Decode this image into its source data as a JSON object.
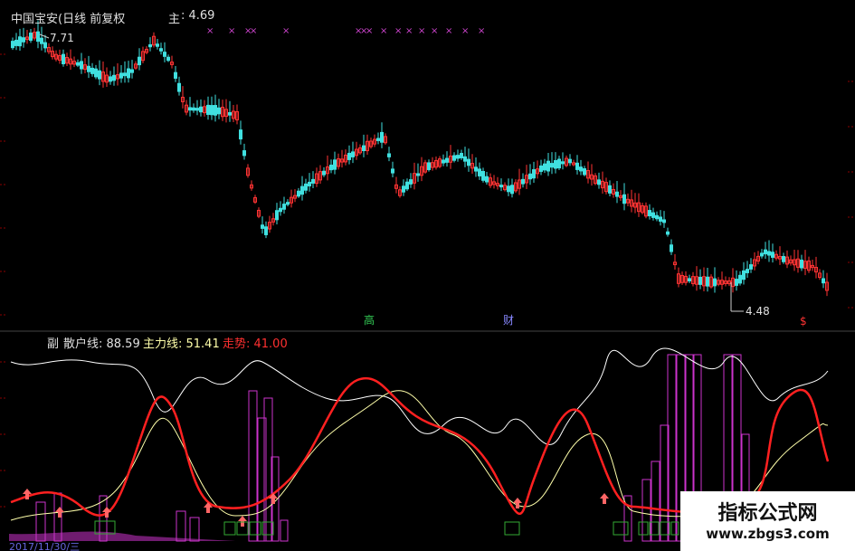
{
  "main_panel": {
    "stock_title": "中国宝安(日线 前复权",
    "price_label": "主",
    "price_value": ": 4.69",
    "high_marker": "7.71",
    "low_marker": "4.48",
    "event_labels": [
      "高",
      "财",
      "$"
    ]
  },
  "sub_panel": {
    "label": "副",
    "retail_line": "散户线: 88.59",
    "main_force_line": "主力线: 51.41",
    "trend_line": "走势: 41.00",
    "date_text": "2017/11/30/三"
  },
  "watermark": {
    "line1": "指标公式网",
    "line2": "www.zbgs3.com"
  },
  "colors": {
    "background": "#000000",
    "up_candle": "#ff3333",
    "down_candle": "#40e0e0",
    "trend_line": "#ff2020",
    "retail_line": "#ffffff",
    "main_force_line": "#ffffaa",
    "bars": "#cc33cc",
    "signal_arrow": "#ff6666",
    "signal_box": "#33aa33",
    "x_markers": "#cc44cc",
    "grid": "#8b0000"
  },
  "icons": [
    "up-arrow-icon",
    "x-marker-icon"
  ]
}
